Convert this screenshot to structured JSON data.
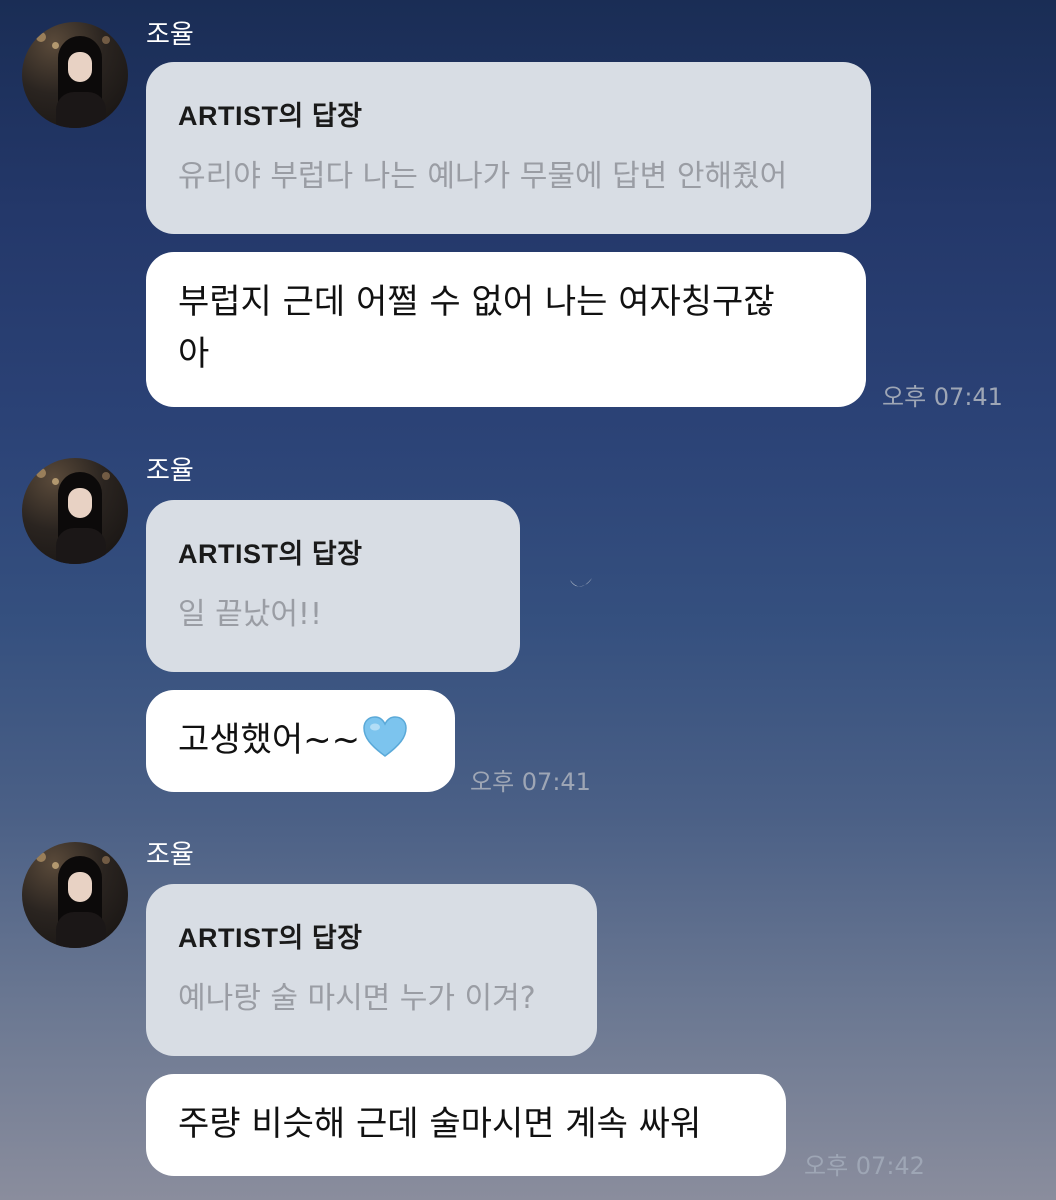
{
  "chat": {
    "messages": [
      {
        "sender": "조율",
        "reply_title": "ARTIST의 답장",
        "reply_text": "유리야 부럽다 나는 예나가 무물에 답변 안해줬어",
        "message_line1": "부럽지 근데 어쩔 수 없어 나는 여자칭구잖",
        "message_line2": "아",
        "time": "오후 07:41"
      },
      {
        "sender": "조율",
        "reply_title": "ARTIST의 답장",
        "reply_text": "일 끝났어!!",
        "message_text": "고생했어~~",
        "message_emoji": "light-blue-heart-icon",
        "time": "오후 07:41"
      },
      {
        "sender": "조율",
        "reply_title": "ARTIST의 답장",
        "reply_text": "예나랑 술 마시면 누가 이겨?",
        "message_text": "주량 비슷해 근데 술마시면 계속 싸워",
        "time": "오후 07:42"
      }
    ]
  },
  "colors": {
    "background_top": "#1a2d55",
    "background_bottom": "#8a8d9d",
    "reply_bubble": "#d8dde4",
    "message_bubble": "#ffffff",
    "reply_text": "#9a9da4",
    "heart": "#7cc4ee"
  },
  "decorations": {
    "moon": "crescent-moon-icon"
  }
}
